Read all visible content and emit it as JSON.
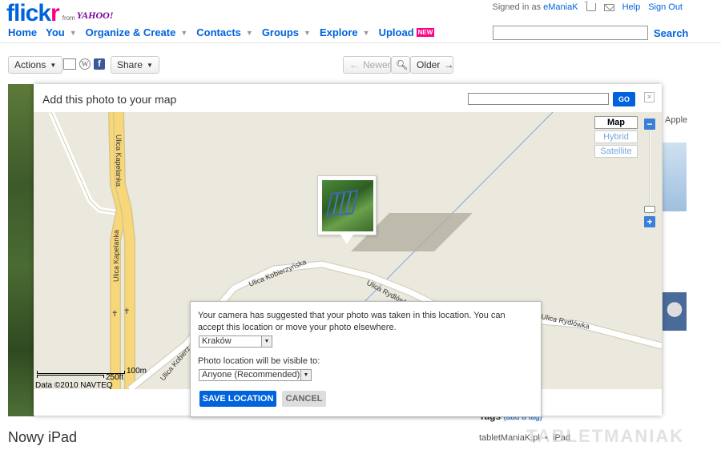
{
  "header": {
    "logo": {
      "text_main": "flick",
      "text_r": "r",
      "from": "from",
      "yahoo": "YAHOO!"
    },
    "signed_in_as": "Signed in as",
    "username": "eManiaK",
    "help": "Help",
    "sign_out": "Sign Out",
    "nav": [
      {
        "label": "Home",
        "has_caret": false
      },
      {
        "label": "You",
        "has_caret": true
      },
      {
        "label": "Organize & Create",
        "has_caret": true
      },
      {
        "label": "Contacts",
        "has_caret": true
      },
      {
        "label": "Groups",
        "has_caret": true
      },
      {
        "label": "Explore",
        "has_caret": true
      },
      {
        "label": "Upload",
        "has_caret": false
      }
    ],
    "upload_badge": "NEW",
    "search_label": "Search",
    "search_value": ""
  },
  "toolbar": {
    "actions": "Actions",
    "share": "Share",
    "newer": "Newer",
    "older": "Older"
  },
  "page": {
    "title": "Nowy iPad",
    "tags_label": "Tags",
    "add_tag": "(add a tag)",
    "tag_source": "tabletManiaK.pl",
    "tag_separator": "•",
    "tag_ipad": "iPad",
    "right_text": "Apple",
    "watermark": "TABLETMANIAK"
  },
  "dialog": {
    "title": "Add this photo to your map",
    "search_value": "",
    "go_label": "GO",
    "close_label": "×",
    "map_types": [
      {
        "label": "Map",
        "active": true
      },
      {
        "label": "Hybrid",
        "active": false
      },
      {
        "label": "Satellite",
        "active": false
      }
    ],
    "zoom_in": "+",
    "zoom_out": "−",
    "scale_m": "100m",
    "scale_ft": "250ft",
    "copyright": "Data ©2010 NAVTEQ",
    "streets": {
      "kapelanka_top": "Ulica Kapelanka",
      "kapelanka": "Ulica Kapelanka",
      "kobierzynska": "Ulica Kobierzyńska",
      "rydlowka1": "Ulica Rydlówka",
      "rydlowka2": "Ulica Rydlówka",
      "kobierz_short": "Ulica Kobierz"
    },
    "panel": {
      "message": "Your camera has suggested that your photo was taken in this location. You can accept this location or move your photo elsewhere.",
      "location_value": "Kraków",
      "visibility_label": "Photo location will be visible to:",
      "visibility_value": "Anyone (Recommended)",
      "save": "SAVE LOCATION",
      "cancel": "CANCEL"
    }
  },
  "colors": {
    "flickr_blue": "#0063dc",
    "flickr_pink": "#ff0084",
    "yahoo_purple": "#7b0099",
    "map_bg": "#ebe8dd",
    "main_road": "#f8d77a"
  }
}
